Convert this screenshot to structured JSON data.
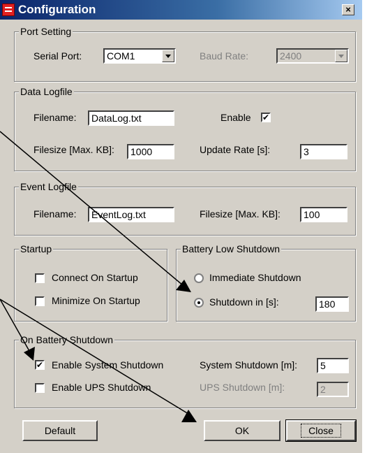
{
  "window": {
    "title": "Configuration",
    "close_label": "×"
  },
  "port_setting": {
    "legend": "Port Setting",
    "serial_port_label": "Serial Port:",
    "serial_port_value": "COM1",
    "baud_rate_label": "Baud Rate:",
    "baud_rate_value": "2400"
  },
  "data_logfile": {
    "legend": "Data Logfile",
    "filename_label": "Filename:",
    "filename_value": "DataLog.txt",
    "enable_label": "Enable",
    "enable_checked": "✔",
    "filesize_label": "Filesize [Max. KB]:",
    "filesize_value": "1000",
    "update_rate_label": "Update Rate [s]:",
    "update_rate_value": "3"
  },
  "event_logfile": {
    "legend": "Event Logfile",
    "filename_label": "Filename:",
    "filename_value": "EventLog.txt",
    "filesize_label": "Filesize [Max. KB]:",
    "filesize_value": "100"
  },
  "startup": {
    "legend": "Startup",
    "connect_label": "Connect On Startup",
    "minimize_label": "Minimize On Startup"
  },
  "battery_low": {
    "legend": "Battery Low Shutdown",
    "immediate_label": "Immediate Shutdown",
    "shutdown_in_label": "Shutdown in [s]:",
    "shutdown_in_value": "180"
  },
  "on_battery": {
    "legend": "On Battery Shutdown",
    "enable_system_label": "Enable System Shutdown",
    "enable_system_checked": "✔",
    "system_shutdown_label": "System Shutdown [m]:",
    "system_shutdown_value": "5",
    "enable_ups_label": "Enable UPS Shutdown",
    "ups_shutdown_label": "UPS Shutdown [m]:",
    "ups_shutdown_value": "2"
  },
  "buttons": {
    "default": "Default",
    "ok": "OK",
    "close": "Close"
  }
}
